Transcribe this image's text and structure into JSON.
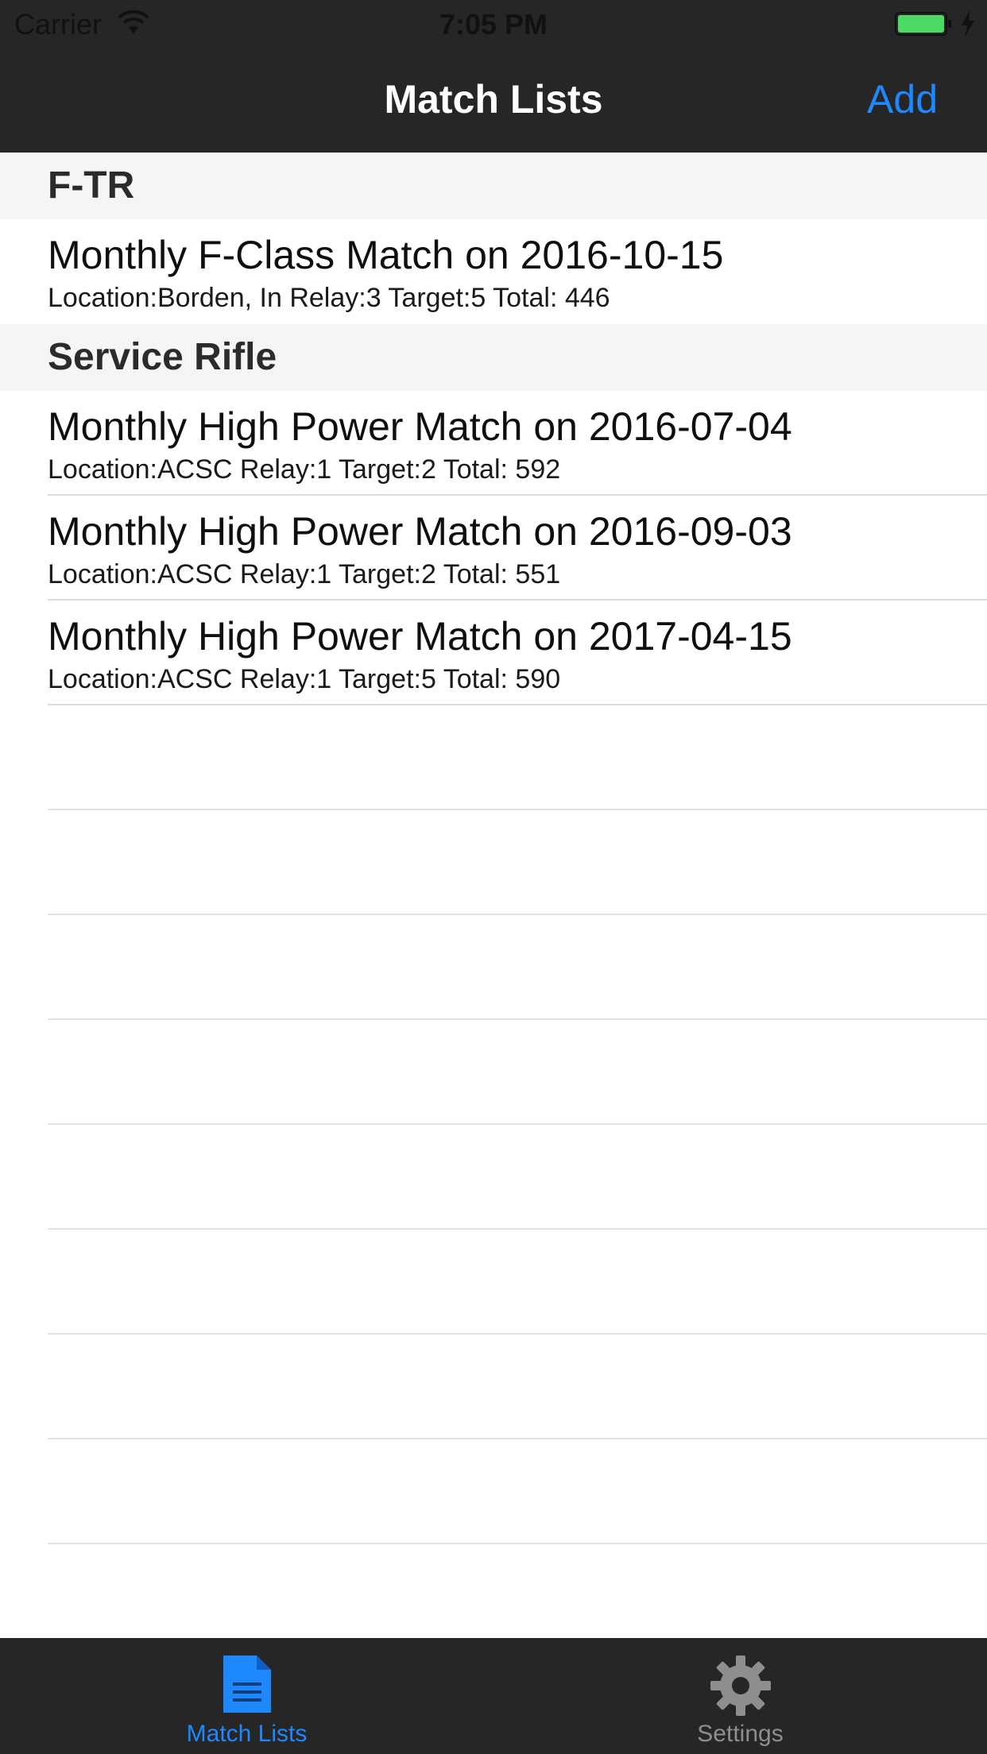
{
  "status_bar": {
    "carrier": "Carrier",
    "time": "7:05 PM"
  },
  "nav": {
    "title": "Match Lists",
    "add_label": "Add"
  },
  "sections": [
    {
      "header": "F-TR",
      "rows": [
        {
          "title": "Monthly F-Class Match on 2016-10-15",
          "subtitle": "Location:Borden, In Relay:3 Target:5 Total: 446"
        }
      ]
    },
    {
      "header": "Service Rifle",
      "rows": [
        {
          "title": "Monthly High Power Match on 2016-07-04",
          "subtitle": "Location:ACSC Relay:1 Target:2 Total: 592"
        },
        {
          "title": "Monthly High Power Match on 2016-09-03",
          "subtitle": "Location:ACSC Relay:1 Target:2 Total: 551"
        },
        {
          "title": "Monthly High Power Match on 2017-04-15",
          "subtitle": "Location:ACSC Relay:1 Target:5 Total: 590"
        }
      ]
    }
  ],
  "tabbar": {
    "tabs": [
      {
        "label": "Match Lists",
        "icon": "document-icon",
        "selected": true
      },
      {
        "label": "Settings",
        "icon": "gear-icon",
        "selected": false
      }
    ]
  },
  "colors": {
    "bar_background": "#262626",
    "accent": "#1e88ff",
    "battery": "#4cd964",
    "inactive_tab": "#8e8e8e"
  }
}
